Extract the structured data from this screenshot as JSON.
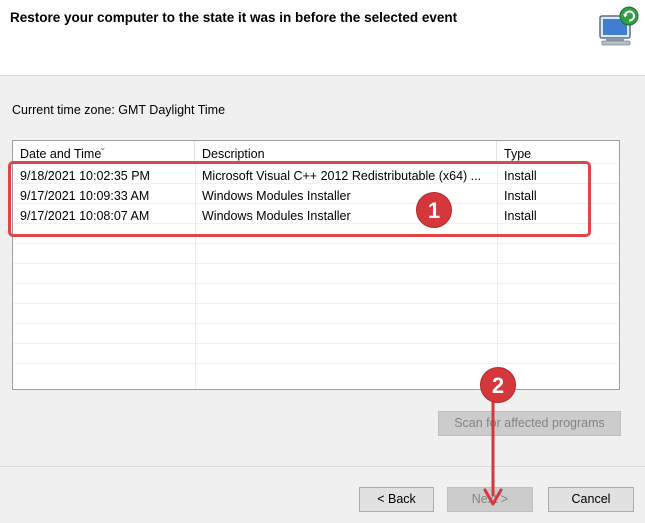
{
  "header": {
    "title": "Restore your computer to the state it was in before the selected event",
    "icon": "system-restore-computer-icon"
  },
  "timezone_label": "Current time zone: GMT Daylight Time",
  "table": {
    "columns": [
      "Date and Time",
      "Description",
      "Type"
    ],
    "sort_icon": "sort-chevron-icon",
    "rows": [
      {
        "date": "9/18/2021 10:02:35 PM",
        "description": "Microsoft Visual C++ 2012 Redistributable (x64) ...",
        "type": "Install"
      },
      {
        "date": "9/17/2021 10:09:33 AM",
        "description": "Windows Modules Installer",
        "type": "Install"
      },
      {
        "date": "9/17/2021 10:08:07 AM",
        "description": "Windows Modules Installer",
        "type": "Install"
      }
    ]
  },
  "annotations": {
    "badge_1": "1",
    "badge_2": "2",
    "highlight_color": "#e04548",
    "badge_color": "#d5373b"
  },
  "buttons": {
    "scan": "Scan for affected programs",
    "back": "< Back",
    "next": "Next >",
    "cancel": "Cancel"
  }
}
